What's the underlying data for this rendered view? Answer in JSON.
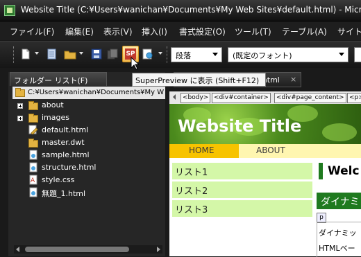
{
  "window": {
    "title": "Website Title (C:¥Users¥wanichan¥Documents¥My Web Sites¥default.html) - Micro"
  },
  "menu": [
    "ファイル(F)",
    "編集(E)",
    "表示(V)",
    "挿入(I)",
    "書式設定(O)",
    "ツール(T)",
    "テーブル(A)",
    "サイト"
  ],
  "toolbar": {
    "paragraph_select": "段落",
    "font_select": "(既定のフォント)",
    "superpreview_label": "SP"
  },
  "tooltip": "SuperPreview に表示 (Shift+F12)",
  "folder_panel": {
    "title": "フォルダー リスト(F)",
    "root_path": "C:¥Users¥wanichan¥Documents¥My W",
    "items": [
      {
        "label": "about",
        "type": "folder",
        "expandable": true
      },
      {
        "label": "images",
        "type": "folder",
        "expandable": true
      },
      {
        "label": "default.html",
        "type": "html-edit"
      },
      {
        "label": "master.dwt",
        "type": "folder-file"
      },
      {
        "label": "sample.html",
        "type": "html"
      },
      {
        "label": "structure.html",
        "type": "html"
      },
      {
        "label": "style.css",
        "type": "css"
      },
      {
        "label": "無題_1.html",
        "type": "html"
      }
    ]
  },
  "editor": {
    "tab_label": "t.html",
    "tab_close": "×",
    "tags": [
      "<body>",
      "<div#container>",
      "<div#page_content>",
      "<p>"
    ],
    "site_title": "Website Title",
    "nav": [
      "HOME",
      "ABOUT"
    ],
    "side_list": [
      "リスト1",
      "リスト2",
      "リスト3"
    ],
    "welcome": "Welc",
    "dyna_heading": "ダイナミ",
    "p_tag": "p",
    "paragraph_lines": [
      "ダイナミッ",
      "HTMLベー"
    ]
  },
  "colors": {
    "nav_home_bg": "#f7c300",
    "nav_bg": "#fff6b0",
    "side_item_bg": "#d4f7a8",
    "accent_green": "#1f7a1f"
  }
}
